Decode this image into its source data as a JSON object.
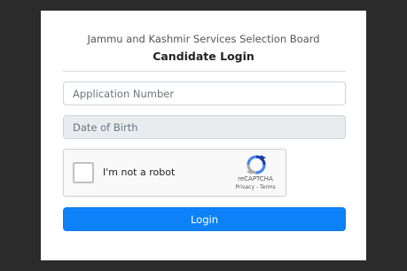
{
  "header": {
    "organization": "Jammu and Kashmir Services Selection Board",
    "title": "Candidate Login"
  },
  "form": {
    "application_number": {
      "value": "",
      "placeholder": "Application Number"
    },
    "date_of_birth": {
      "value": "",
      "placeholder": "Date of Birth"
    },
    "submit_label": "Login"
  },
  "captcha": {
    "label": "I'm not a robot",
    "brand": "reCAPTCHA",
    "links": "Privacy - Terms",
    "checked": false,
    "icon": "recaptcha-logo-icon"
  },
  "colors": {
    "background": "#2b2b2b",
    "card": "#ffffff",
    "button": "#0d82f8",
    "disabled_field": "#e9ecef"
  }
}
